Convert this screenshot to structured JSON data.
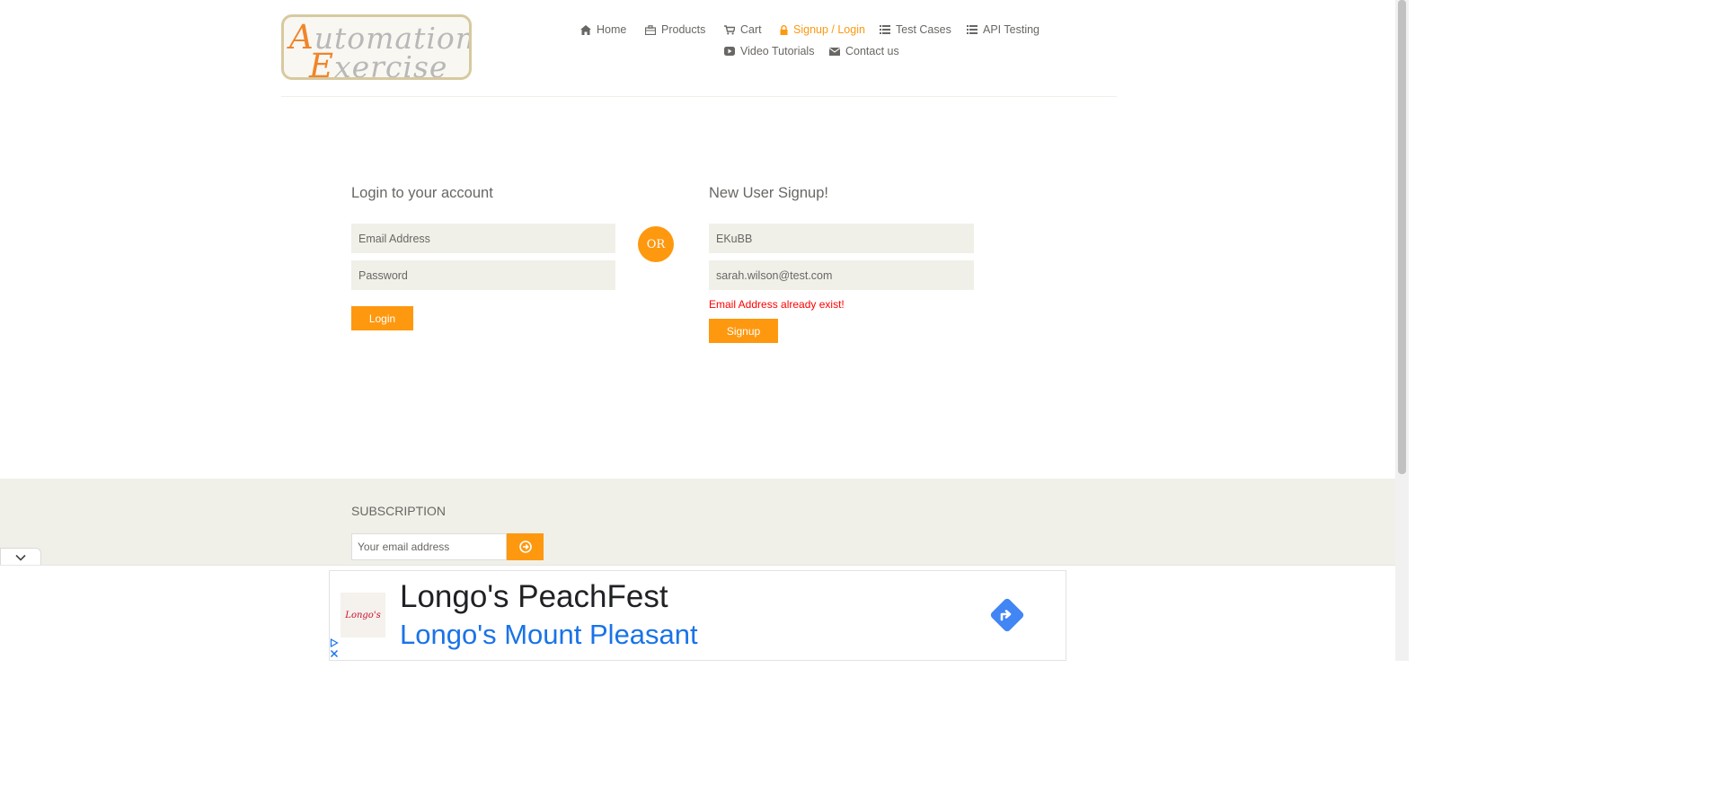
{
  "brand": {
    "line1_cap": "A",
    "line1_rest": "utomation",
    "line2_cap": "E",
    "line2_rest": "xercise"
  },
  "nav": {
    "home": "Home",
    "products": "Products",
    "cart": "Cart",
    "signup_login": "Signup / Login",
    "test_cases": "Test Cases",
    "api_testing": "API Testing",
    "video_tutorials": "Video Tutorials",
    "contact_us": "Contact us"
  },
  "login": {
    "title": "Login to your account",
    "email_placeholder": "Email Address",
    "password_placeholder": "Password",
    "button": "Login"
  },
  "or_label": "OR",
  "signup": {
    "title": "New User Signup!",
    "name_value": "EKuBB",
    "email_value": "sarah.wilson@test.com",
    "error": "Email Address already exist!",
    "button": "Signup"
  },
  "subscription": {
    "title": "SUBSCRIPTION",
    "placeholder": "Your email address"
  },
  "ad": {
    "logo_text": "Longo's",
    "title": "Longo's PeachFest",
    "subtitle": "Longo's Mount Pleasant"
  },
  "colors": {
    "accent": "#fe980f",
    "text": "#696763",
    "field_bg": "#f0f0e9",
    "error": "#ff0000",
    "ad_link": "#1a73e8"
  }
}
